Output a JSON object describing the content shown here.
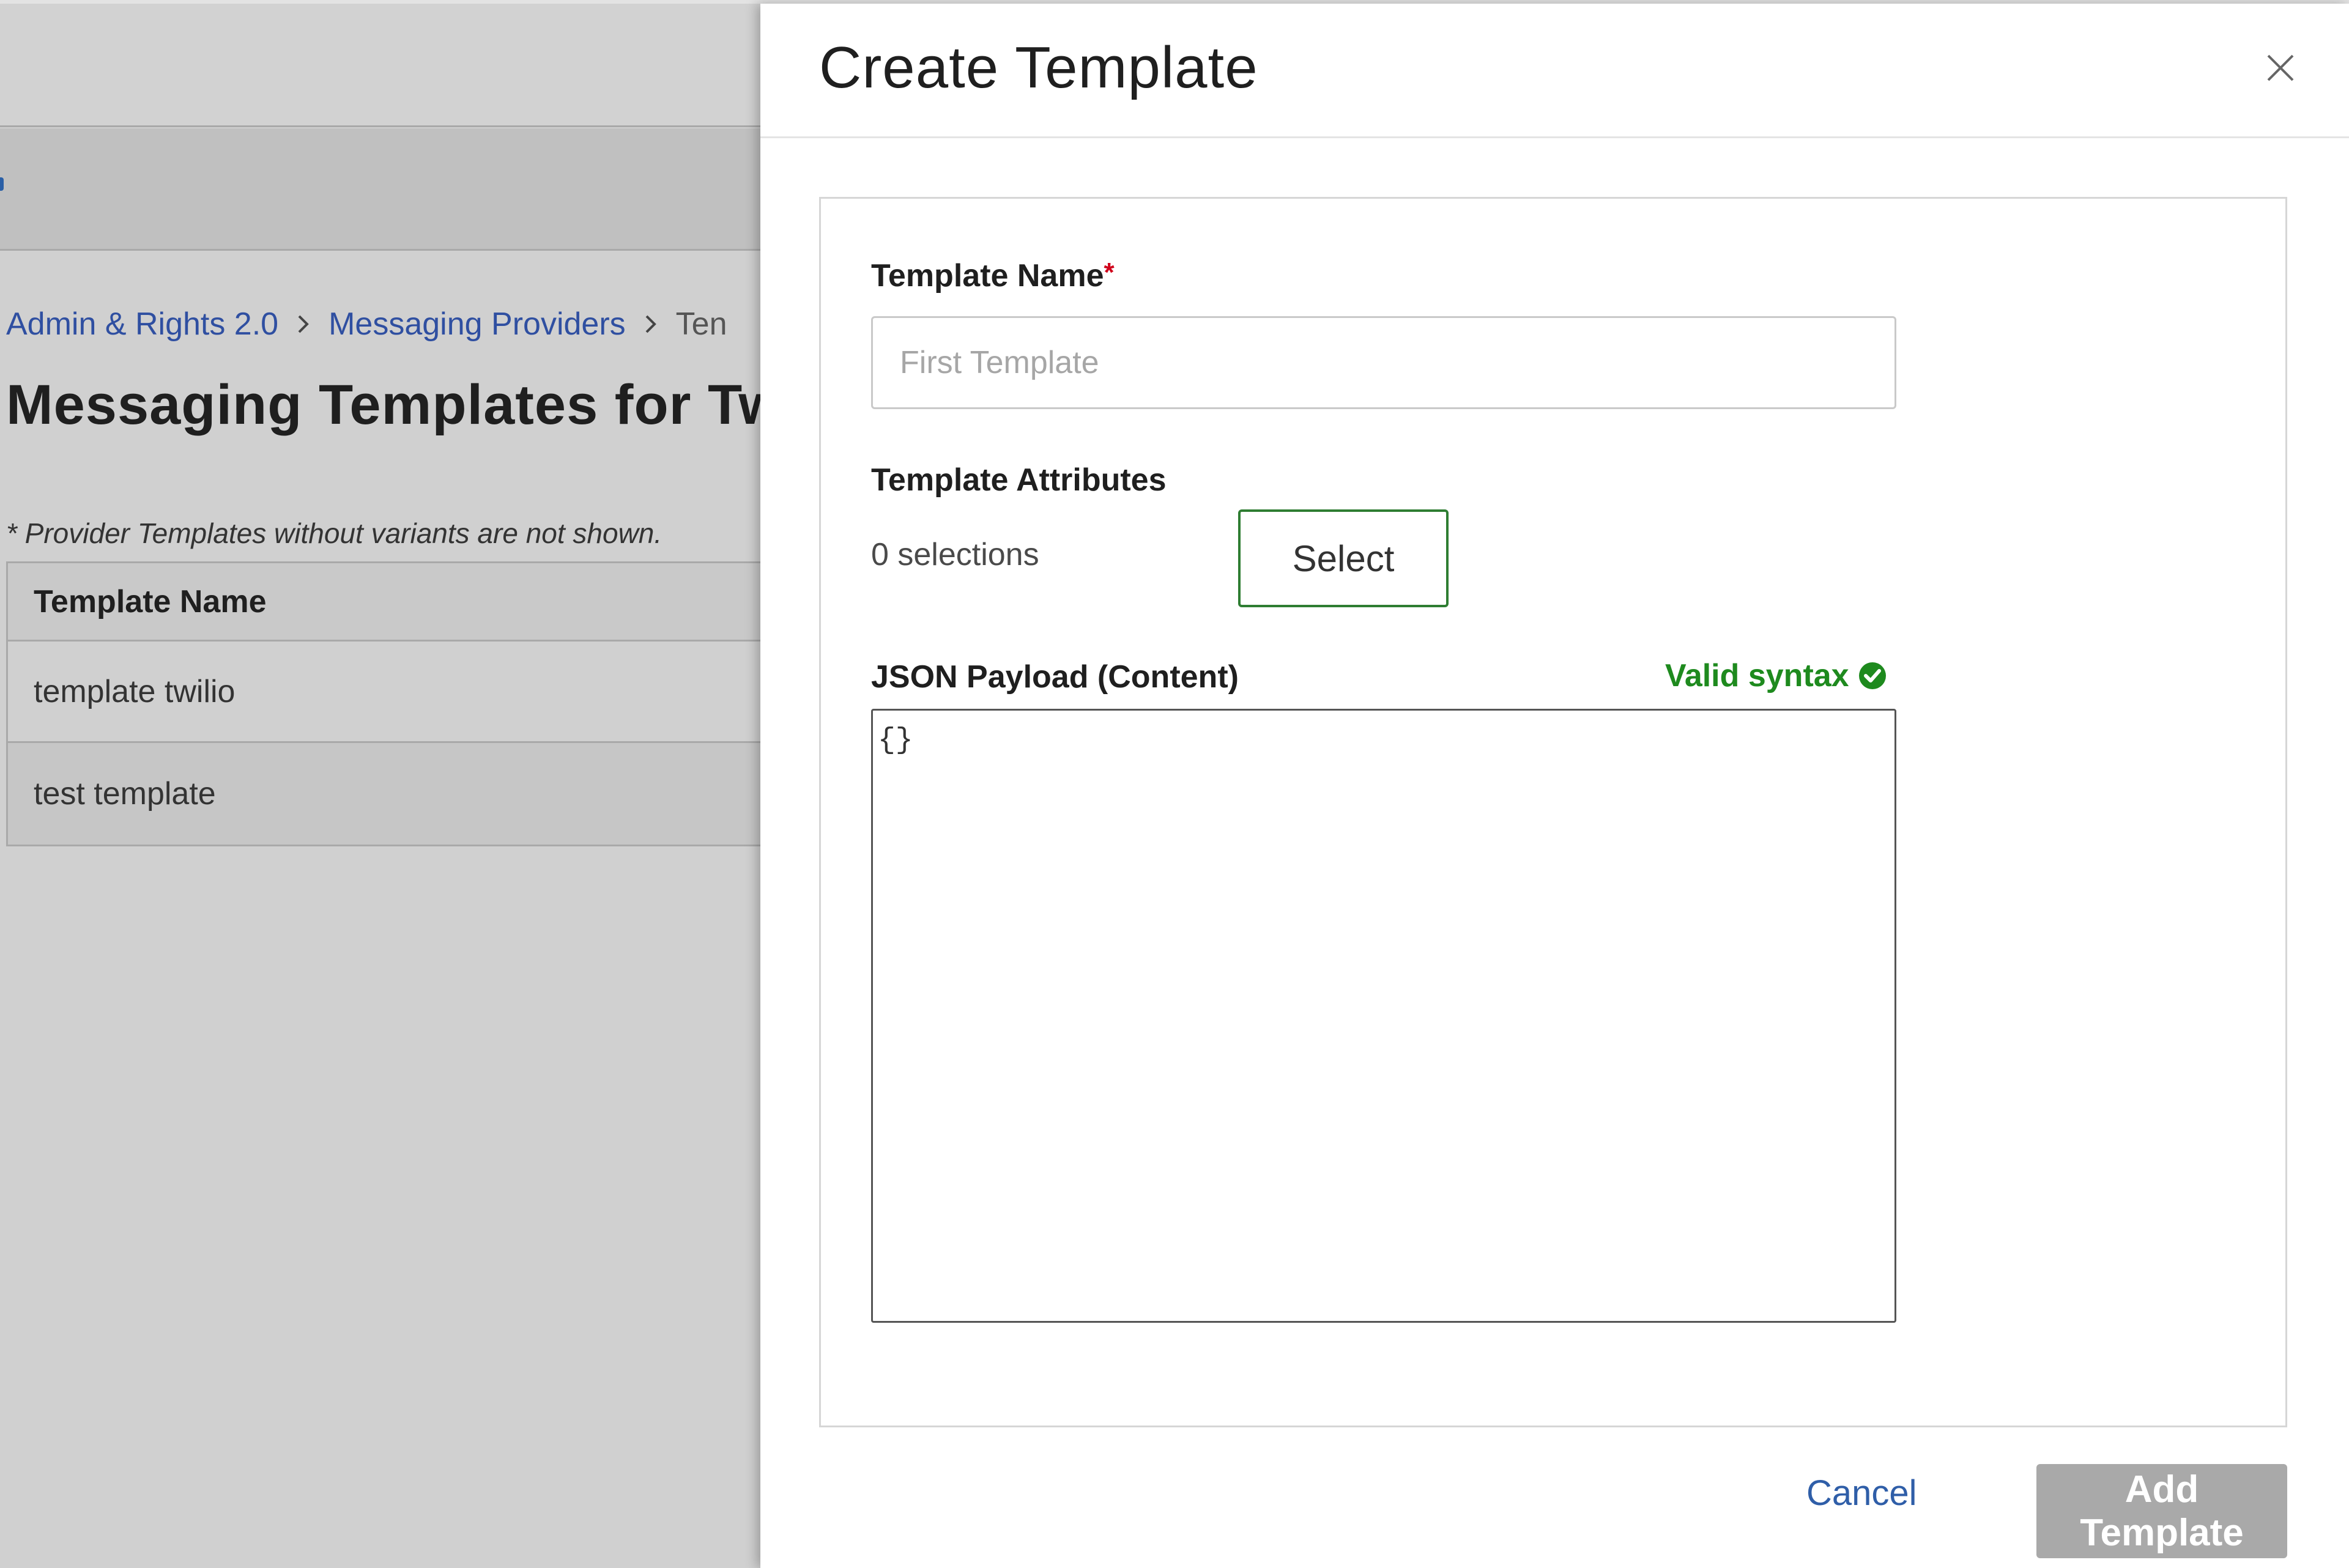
{
  "background": {
    "breadcrumb": {
      "items": [
        "Admin & Rights 2.0",
        "Messaging Providers"
      ],
      "current": "Ten"
    },
    "page_title": "Messaging Templates for Tw",
    "note": "* Provider Templates without variants are not shown.",
    "table": {
      "header": "Template Name",
      "rows": [
        "template twilio",
        "test template"
      ]
    }
  },
  "drawer": {
    "title": "Create Template",
    "close_icon": "close-icon",
    "template_name": {
      "label": "Template Name",
      "required_mark": "*",
      "placeholder": "First Template",
      "value": ""
    },
    "template_attributes": {
      "label": "Template Attributes",
      "selections_text": "0 selections",
      "select_button": "Select"
    },
    "json_payload": {
      "label": "JSON Payload (Content)",
      "validity_text": "Valid syntax",
      "validity_icon": "check-circle-icon",
      "value": "{}"
    },
    "footer": {
      "cancel": "Cancel",
      "submit": "Add Template"
    }
  },
  "colors": {
    "overlay_bg": "#d0d0d0",
    "link": "#2f4fa1",
    "valid_green": "#1e8a1e",
    "select_border": "#2e7d32",
    "disabled_button": "#a9a9a9",
    "required_red": "#d0021b"
  }
}
